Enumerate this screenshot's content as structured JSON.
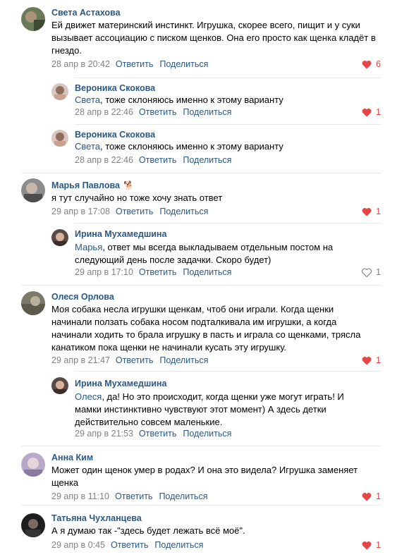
{
  "comments": [
    {
      "author": "Света Астахова",
      "text": "Ей движет материнский инстинкт. Игрушка, скорее всего, пищит и у суки вызывает ассоциацию с писком щенков. Она его просто как щенка кладёт в гнездо.",
      "date": "28 апр в 20:42",
      "reply": "Ответить",
      "share": "Поделиться",
      "likes": "6",
      "liked": true
    },
    {
      "author": "Вероника Скокова",
      "mention": "Света",
      "text": ", тоже склоняюсь именно к этому варианту",
      "date": "28 апр в 22:46",
      "reply": "Ответить",
      "share": "Поделиться",
      "likes": "1",
      "liked": true
    },
    {
      "author": "Вероника Скокова",
      "mention": "Света",
      "text": ", тоже склоняюсь именно к этому варианту",
      "date": "28 апр в 22:46",
      "reply": "Ответить",
      "share": "Поделиться",
      "likes": "",
      "liked": false
    },
    {
      "author": "Марья Павлова",
      "badge": "🐕",
      "text": "я тут случайно но тоже хочу знать ответ",
      "date": "29 апр в 17:08",
      "reply": "Ответить",
      "share": "Поделиться",
      "likes": "1",
      "liked": true
    },
    {
      "author": "Ирина Мухамедшина",
      "mention": "Марья",
      "text": ", ответ мы всегда выкладываем отдельным постом на следующий день после задачки. Скоро будет)",
      "date": "29 апр в 17:10",
      "reply": "Ответить",
      "share": "Поделиться",
      "likes": "1",
      "liked": false
    },
    {
      "author": "Олеся Орлова",
      "text": "Моя собака несла игрушки щенкам, чтоб они играли. Когда щенки начинали ползать собака носом подталкивала им игрушки, а когда начинали ходить то брала игрушку в пасть и играла со щенками, трясла канатиком пока щенки не начинали кусать эту игрушку.",
      "date": "29 апр в 21:47",
      "reply": "Ответить",
      "share": "Поделиться",
      "likes": "1",
      "liked": true
    },
    {
      "author": "Ирина Мухамедшина",
      "mention": "Олеся",
      "text": ", да! Но это происходит, когда щенки уже могут играть! И мамки инстинктивно чувствуют этот момент) А здесь детки действительно совсем маленькие.",
      "date": "29 апр в 21:53",
      "reply": "Ответить",
      "share": "Поделиться",
      "likes": "",
      "liked": false
    },
    {
      "author": "Анна Ким",
      "text": "Может один щенок умер в родах? И она это видела? Игрушка заменяет щенка",
      "date": "29 апр в 11:10",
      "reply": "Ответить",
      "share": "Поделиться",
      "likes": "1",
      "liked": true
    },
    {
      "author": "Татьяна Чухланцева",
      "text": "А я думаю так -\"здесь будет лежать всё моё\".",
      "date": "29 апр в 0:45",
      "reply": "Ответить",
      "share": "Поделиться",
      "likes": "1",
      "liked": true
    }
  ],
  "colors": {
    "link": "#2a5885",
    "meta": "#828282",
    "like_active": "#e64646",
    "separator": "#e7e8ec"
  },
  "icons": {
    "like": "heart-icon"
  }
}
